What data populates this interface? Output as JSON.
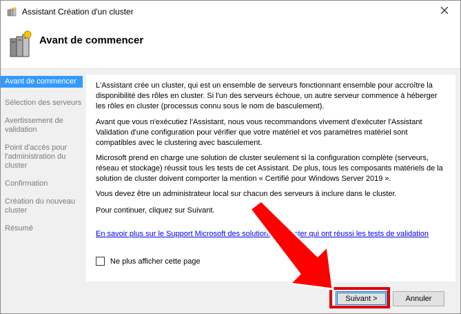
{
  "window": {
    "title": "Assistant Création d'un cluster"
  },
  "header": {
    "title": "Avant de commencer"
  },
  "nav": {
    "items": [
      {
        "label": "Avant de commencer"
      },
      {
        "label": "Sélection des serveurs"
      },
      {
        "label": "Avertissement de validation"
      },
      {
        "label": "Point d'accès pour l'administration du cluster"
      },
      {
        "label": "Confirmation"
      },
      {
        "label": "Création du nouveau cluster"
      },
      {
        "label": "Résumé"
      }
    ]
  },
  "content": {
    "p1": "L'Assistant crée un cluster, qui est un ensemble de serveurs fonctionnant ensemble pour accroître la disponibilité des rôles en cluster. Si l'un des serveurs échoue, un autre serveur commence à héberger les rôles en cluster (processus connu sous le nom de basculement).",
    "p2": "Avant que vous n'exécutiez l'Assistant, nous vous recommandons vivement d'exécuter l'Assistant Validation d'une configuration pour vérifier que votre matériel et vos paramètres matériel sont compatibles avec le clustering avec basculement.",
    "p3": "Microsoft prend en charge une solution de cluster seulement si la configuration complète (serveurs, réseau et stockage) réussit tous les tests de cet Assistant. De plus, tous les composants matériels de la solution de cluster doivent comporter la mention « Certifié pour Windows Server 2019 ».",
    "p4": "Vous devez être un administrateur local sur chacun des serveurs à inclure dans le cluster.",
    "p5": "Pour continuer, cliquez sur Suivant.",
    "link": "En savoir plus sur le Support Microsoft des solutions de cluster qui ont réussi les tests de validation",
    "checkbox_label": "Ne plus afficher cette page"
  },
  "buttons": {
    "next": "Suivant >",
    "cancel": "Annuler"
  },
  "colors": {
    "nav_active": "#3399ff",
    "link": "#0000ee",
    "highlight": "#e00000"
  },
  "icons": {
    "title": "cluster-icon",
    "header": "cluster-servers-icon",
    "close": "close-icon",
    "arrow": "red-arrow-icon"
  }
}
